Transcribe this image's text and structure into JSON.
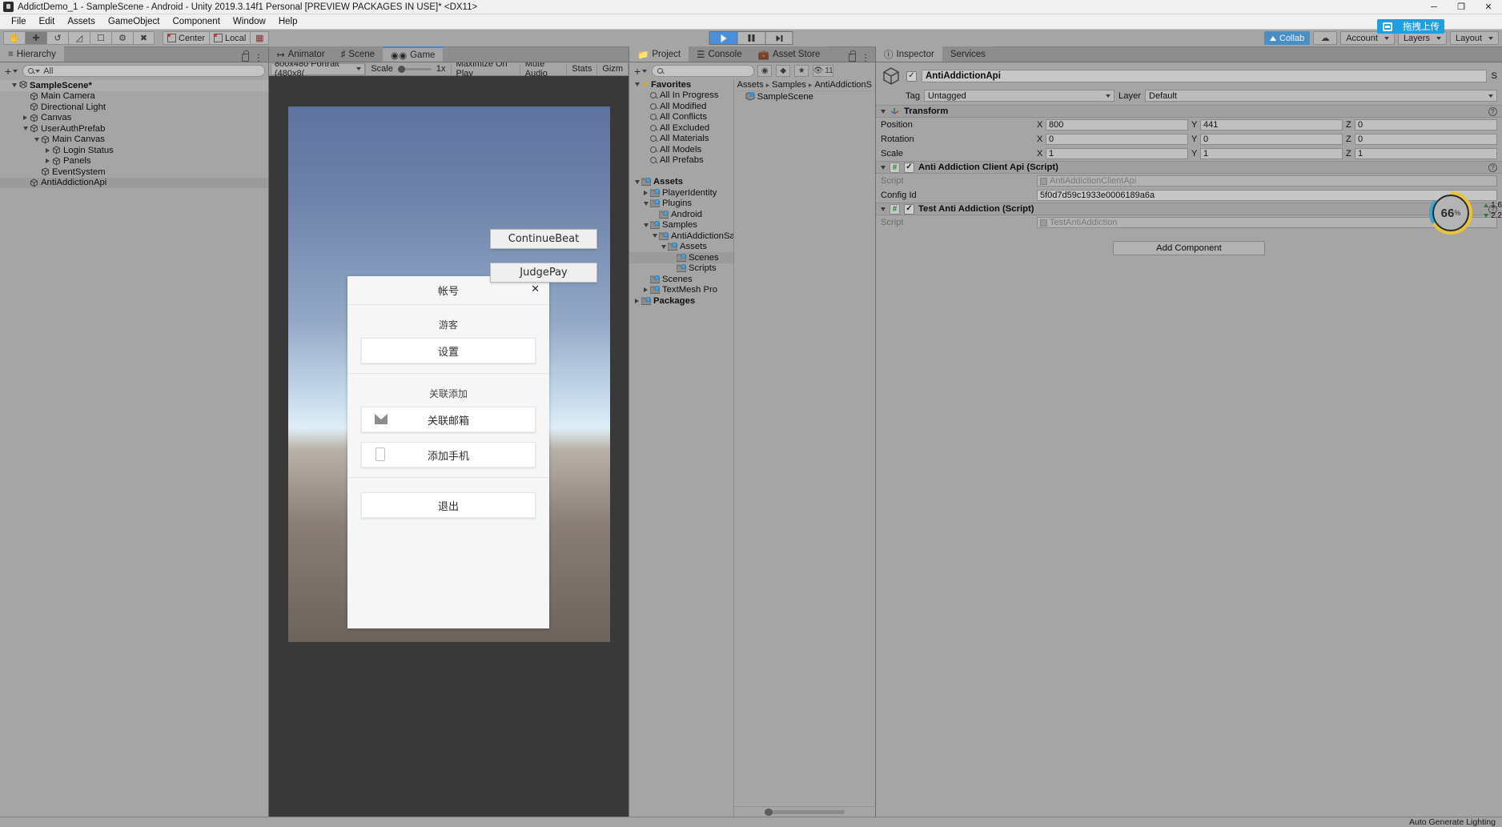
{
  "window": {
    "title": "AddictDemo_1 - SampleScene - Android - Unity 2019.3.14f1 Personal [PREVIEW PACKAGES IN USE]* <DX11>",
    "minimize": "─",
    "maximize": "❐",
    "close": "✕"
  },
  "menu": [
    "File",
    "Edit",
    "Assets",
    "GameObject",
    "Component",
    "Window",
    "Help"
  ],
  "toolbar": {
    "tools": [
      "hand-tool",
      "move-tool",
      "rotate-tool",
      "scale-tool",
      "rect-tool",
      "transform-tool",
      "custom-tool"
    ],
    "pivot": "Center",
    "space": "Local",
    "collab_label": "Collab",
    "account_label": "Account",
    "layers_label": "Layers",
    "layout_label": "Layout",
    "upload_label": "拖拽上传"
  },
  "hierarchy": {
    "tab": "Hierarchy",
    "search_placeholder": "All",
    "items": [
      {
        "label": "SampleScene*",
        "depth": 0,
        "arrow": "down",
        "icon": "scene-icon",
        "bold": true,
        "selected": false
      },
      {
        "label": "Main Camera",
        "depth": 1,
        "arrow": "none",
        "icon": "gameobject-icon",
        "bold": false,
        "selected": false
      },
      {
        "label": "Directional Light",
        "depth": 1,
        "arrow": "none",
        "icon": "gameobject-icon",
        "bold": false,
        "selected": false
      },
      {
        "label": "Canvas",
        "depth": 1,
        "arrow": "right",
        "icon": "gameobject-icon",
        "bold": false,
        "selected": false
      },
      {
        "label": "UserAuthPrefab",
        "depth": 1,
        "arrow": "down",
        "icon": "gameobject-icon",
        "bold": false,
        "selected": false
      },
      {
        "label": "Main Canvas",
        "depth": 2,
        "arrow": "down",
        "icon": "gameobject-icon",
        "bold": false,
        "selected": false
      },
      {
        "label": "Login Status",
        "depth": 3,
        "arrow": "right",
        "icon": "gameobject-icon",
        "bold": false,
        "selected": false
      },
      {
        "label": "Panels",
        "depth": 3,
        "arrow": "right",
        "icon": "gameobject-icon",
        "bold": false,
        "selected": false
      },
      {
        "label": "EventSystem",
        "depth": 2,
        "arrow": "none",
        "icon": "gameobject-icon",
        "bold": false,
        "selected": false
      },
      {
        "label": "AntiAddictionApi",
        "depth": 1,
        "arrow": "none",
        "icon": "gameobject-icon",
        "bold": false,
        "selected": true
      }
    ]
  },
  "gameview": {
    "tabs": [
      {
        "label": "Animator",
        "icon": "animator-icon",
        "selected": false
      },
      {
        "label": "Scene",
        "icon": "scene-grid-icon",
        "selected": false
      },
      {
        "label": "Game",
        "icon": "gamepad-icon",
        "selected": true
      }
    ],
    "resolution": "800x480 Portrait (480x8(",
    "scale_label": "Scale",
    "scale_value": "1x",
    "maximize": "Maximize On Play",
    "mute": "Mute Audio",
    "stats": "Stats",
    "gizmos": "Gizm"
  },
  "dialog": {
    "title": "帐号",
    "close": "✕",
    "guest_label": "游客",
    "settings_button": "设置",
    "link_section_label": "关联添加",
    "link_email_button": "关联邮箱",
    "add_phone_button": "添加手机",
    "logout_button": "退出",
    "overlay_buttons": [
      "ContinueBeat",
      "JudgePay"
    ]
  },
  "project": {
    "tabs": [
      {
        "label": "Project",
        "icon": "folder-icon",
        "selected": true
      },
      {
        "label": "Console",
        "icon": "console-icon",
        "selected": false
      },
      {
        "label": "Asset Store",
        "icon": "store-icon",
        "selected": false
      }
    ],
    "search_placeholder": "",
    "visible_count": "11",
    "tree": [
      {
        "label": "Favorites",
        "depth": 0,
        "arrow": "down",
        "icon": "star-icon",
        "bold": true
      },
      {
        "label": "All In Progress",
        "depth": 1,
        "arrow": "none",
        "icon": "search-icon",
        "bold": false
      },
      {
        "label": "All Modified",
        "depth": 1,
        "arrow": "none",
        "icon": "search-icon",
        "bold": false
      },
      {
        "label": "All Conflicts",
        "depth": 1,
        "arrow": "none",
        "icon": "search-icon",
        "bold": false
      },
      {
        "label": "All Excluded",
        "depth": 1,
        "arrow": "none",
        "icon": "search-icon",
        "bold": false
      },
      {
        "label": "All Materials",
        "depth": 1,
        "arrow": "none",
        "icon": "search-icon",
        "bold": false
      },
      {
        "label": "All Models",
        "depth": 1,
        "arrow": "none",
        "icon": "search-icon",
        "bold": false
      },
      {
        "label": "All Prefabs",
        "depth": 1,
        "arrow": "none",
        "icon": "search-icon",
        "bold": false
      },
      {
        "label": "",
        "depth": 0,
        "arrow": "none",
        "icon": "none",
        "bold": false
      },
      {
        "label": "Assets",
        "depth": 0,
        "arrow": "down",
        "icon": "folder-icon",
        "bold": true
      },
      {
        "label": "PlayerIdentity",
        "depth": 1,
        "arrow": "right",
        "icon": "folder-icon",
        "bold": false
      },
      {
        "label": "Plugins",
        "depth": 1,
        "arrow": "down",
        "icon": "folder-icon",
        "bold": false
      },
      {
        "label": "Android",
        "depth": 2,
        "arrow": "none",
        "icon": "folder-icon",
        "bold": false
      },
      {
        "label": "Samples",
        "depth": 1,
        "arrow": "down",
        "icon": "folder-icon",
        "bold": false
      },
      {
        "label": "AntiAddictionSam",
        "depth": 2,
        "arrow": "down",
        "icon": "folder-icon",
        "bold": false
      },
      {
        "label": "Assets",
        "depth": 3,
        "arrow": "down",
        "icon": "folder-icon",
        "bold": false
      },
      {
        "label": "Scenes",
        "depth": 4,
        "arrow": "none",
        "icon": "folder-icon",
        "bold": false,
        "selected": true
      },
      {
        "label": "Scripts",
        "depth": 4,
        "arrow": "none",
        "icon": "folder-icon",
        "bold": false
      },
      {
        "label": "Scenes",
        "depth": 1,
        "arrow": "none",
        "icon": "folder-icon",
        "bold": false
      },
      {
        "label": "TextMesh Pro",
        "depth": 1,
        "arrow": "right",
        "icon": "folder-icon",
        "bold": false
      },
      {
        "label": "Packages",
        "depth": 0,
        "arrow": "right",
        "icon": "folder-icon",
        "bold": true
      }
    ],
    "breadcrumb": [
      "Assets",
      "Samples",
      "AntiAddictionS"
    ],
    "assets": [
      {
        "label": "SampleScene",
        "icon": "scene-asset-icon"
      }
    ]
  },
  "inspector": {
    "tabs": [
      {
        "label": "Inspector",
        "icon": "info-icon",
        "selected": true
      },
      {
        "label": "Services",
        "icon": "services-icon",
        "selected": false
      }
    ],
    "object_name": "AntiAddictionApi",
    "static_label": "S",
    "tag_label": "Tag",
    "tag_value": "Untagged",
    "layer_label": "Layer",
    "layer_value": "Default",
    "transform": {
      "title": "Transform",
      "rows": [
        {
          "label": "Position",
          "x": "800",
          "y": "441",
          "z": "0"
        },
        {
          "label": "Rotation",
          "x": "0",
          "y": "0",
          "z": "0"
        },
        {
          "label": "Scale",
          "x": "1",
          "y": "1",
          "z": "1"
        }
      ],
      "axes": [
        "X",
        "Y",
        "Z"
      ]
    },
    "components": [
      {
        "title": "Anti Addiction Client Api (Script)",
        "fields": [
          {
            "label": "Script",
            "value": "AntiAddictionClientApi",
            "type": "object"
          },
          {
            "label": "Config Id",
            "value": "5f0d7d59c1933e0006189a6a",
            "type": "text"
          }
        ]
      },
      {
        "title": "Test Anti Addiction (Script)",
        "fields": [
          {
            "label": "Script",
            "value": "TestAntiAddiction",
            "type": "object"
          }
        ]
      }
    ],
    "add_component": "Add Component"
  },
  "stats_overlay": {
    "value": "66",
    "unit": "%",
    "line1": "1.6",
    "line2": "2.2"
  },
  "statusbar": {
    "text": "Auto Generate Lighting"
  },
  "colors": {
    "accent_blue": "#4b8ec4",
    "panel_gray": "#a5a5a5",
    "toolbar_gray": "#8d8d8d",
    "upload_blue": "#1e9fe0"
  }
}
